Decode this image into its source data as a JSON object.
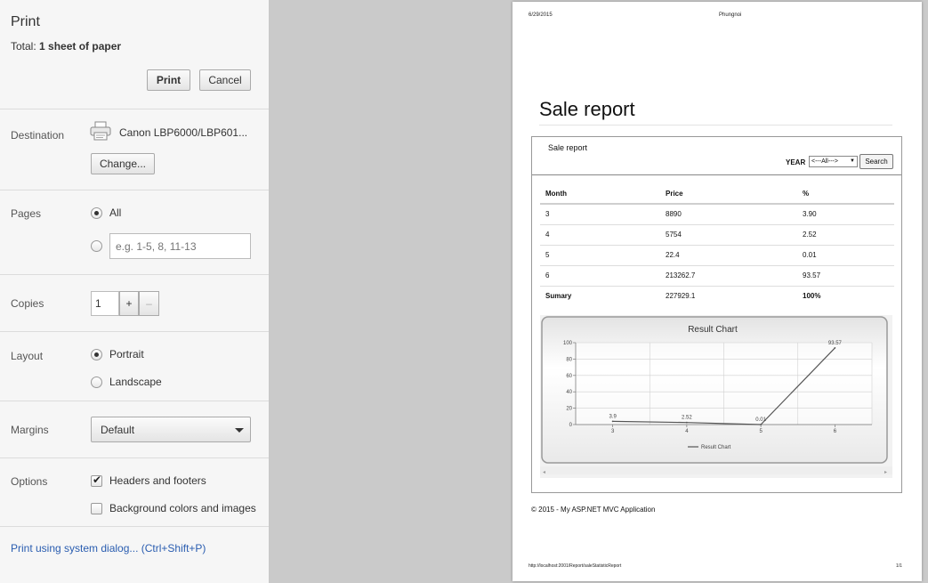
{
  "print_panel": {
    "title": "Print",
    "total_label": "Total:",
    "total_value": "1 sheet of paper",
    "print_button": "Print",
    "cancel_button": "Cancel",
    "destination": {
      "label": "Destination",
      "printer_name": "Canon LBP6000/LBP601...",
      "printer_icon": "printer-icon",
      "change_button": "Change..."
    },
    "pages": {
      "label": "Pages",
      "all_label": "All",
      "all_selected": true,
      "custom_placeholder": "e.g. 1-5, 8, 11-13",
      "custom_value": ""
    },
    "copies": {
      "label": "Copies",
      "value": "1",
      "plus": "+",
      "minus": "–"
    },
    "layout": {
      "label": "Layout",
      "portrait": "Portrait",
      "landscape": "Landscape",
      "selected": "Portrait"
    },
    "margins": {
      "label": "Margins",
      "value": "Default"
    },
    "options": {
      "label": "Options",
      "headers_footers": "Headers and footers",
      "headers_footers_checked": true,
      "background": "Background colors and images",
      "background_checked": false
    },
    "system_dialog_link": "Print using system dialog... (Ctrl+Shift+P)"
  },
  "preview": {
    "header_date": "6/29/2015",
    "header_title": "Phungnoi",
    "heading": "Sale report",
    "box_title": "Sale report",
    "year_label": "YEAR",
    "year_select": "<---All--->",
    "search_button": "Search",
    "table": {
      "headers": [
        "Month",
        "Price",
        "%"
      ],
      "rows": [
        [
          "3",
          "8890",
          "3.90"
        ],
        [
          "4",
          "5754",
          "2.52"
        ],
        [
          "5",
          "22.4",
          "0.01"
        ],
        [
          "6",
          "213262.7",
          "93.57"
        ]
      ],
      "summary": [
        "Sumary",
        "227929.1",
        "100%"
      ]
    },
    "footer_text": "© 2015 - My ASP.NET MVC Application",
    "footer_url": "http://localhost:2001/Report/saleStatisticReport",
    "page_number": "1/1"
  },
  "chart_data": {
    "type": "line",
    "title": "Result Chart",
    "x": [
      "3",
      "4",
      "5",
      "6"
    ],
    "series": [
      {
        "name": "Result Chart",
        "values": [
          3.9,
          2.52,
          0.01,
          93.57
        ],
        "labels": [
          "3.9",
          "2.52",
          "0.01",
          "93.57"
        ]
      }
    ],
    "ylim": [
      0,
      100
    ],
    "yticks": [
      "0",
      "20",
      "40",
      "60",
      "80",
      "100"
    ],
    "grid": true,
    "legend": "bottom",
    "line_color": "#555555"
  }
}
